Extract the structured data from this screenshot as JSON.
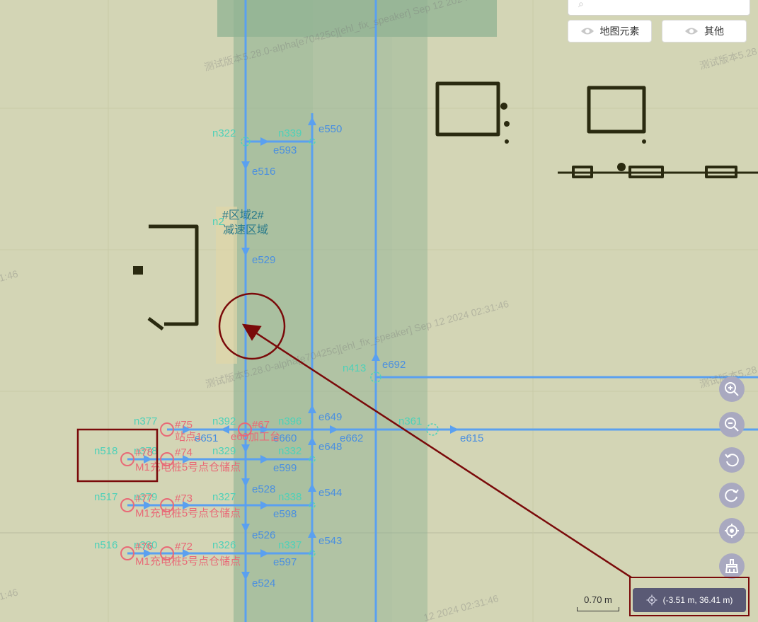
{
  "search": {
    "placeholder": ""
  },
  "layers": {
    "map_elements_label": "地图元素",
    "other_label": "其他"
  },
  "zone": {
    "line1": "#区域2#",
    "line2": "减速区域"
  },
  "scale": {
    "label": "0.70 m"
  },
  "coordinate": {
    "text": "(-3.51 m, 36.41 m)"
  },
  "watermarks": {
    "w1": "测试版本5.28.0-alpha[e70425c][ehl_fix_speaker] Sep 12 2024 02:31:46",
    "w2": "测试版本5.28.0-alpha[e70425c][ehl_fix_speaker] Sep 12 2024 02:31:46",
    "w3": "测试版本5.28",
    "w4": "测试版本5.28",
    "w5": "1:46",
    "w6": "1:46",
    "w7": "12 2024 02:31:46"
  },
  "nodes": {
    "n322": "n322",
    "n339": "n339",
    "n2": "n2",
    "n413": "n413",
    "n361": "n361",
    "n377": "n377",
    "n392": "n392",
    "n396": "n396",
    "n518": "n518",
    "n378": "n378",
    "n329": "n329",
    "n332": "n332",
    "n517": "n517",
    "n379": "n379",
    "n327": "n327",
    "n338": "n338",
    "n516": "n516",
    "n380": "n380",
    "n326": "n326",
    "n337": "n337"
  },
  "edges": {
    "e550": "e550",
    "e593": "e593",
    "e516": "e516",
    "e529": "e529",
    "e692": "e692",
    "e649": "e649",
    "e651": "e651",
    "e660": "e660",
    "e662": "e662",
    "e615": "e615",
    "e648": "e648",
    "e599": "e599",
    "e528": "e528",
    "e544": "e544",
    "e598": "e598",
    "e526": "e526",
    "e543": "e543",
    "e597": "e597",
    "e524": "e524"
  },
  "stations": {
    "s75": "#75",
    "s67": "#67",
    "s67_sub": "e60加工台",
    "s75_sub": "站点1",
    "s78": "#78",
    "s74": "#74",
    "s74_sub": "M1充电桩5号点仓储点",
    "s77": "#77",
    "s73": "#73",
    "s73_sub": "M1充电桩5号点仓储点",
    "s76": "#76",
    "s72": "#72",
    "s72_sub": "M1充电桩5号点仓储点"
  },
  "colors": {
    "background": "#d3d5b5",
    "path": "#5aa0f0",
    "node_label": "#4fd1b8",
    "station": "#e86a77",
    "annotation": "#7a0a0a",
    "obstacle": "#2a2a10"
  },
  "icons": {
    "search": "search-icon",
    "eye": "eye-icon",
    "zoom_in": "zoom-in-icon",
    "zoom_out": "zoom-out-icon",
    "rotate_left": "rotate-left-icon",
    "rotate_right": "rotate-right-icon",
    "locate": "locate-icon",
    "clear": "broom-icon",
    "crosshair": "crosshair-icon"
  }
}
